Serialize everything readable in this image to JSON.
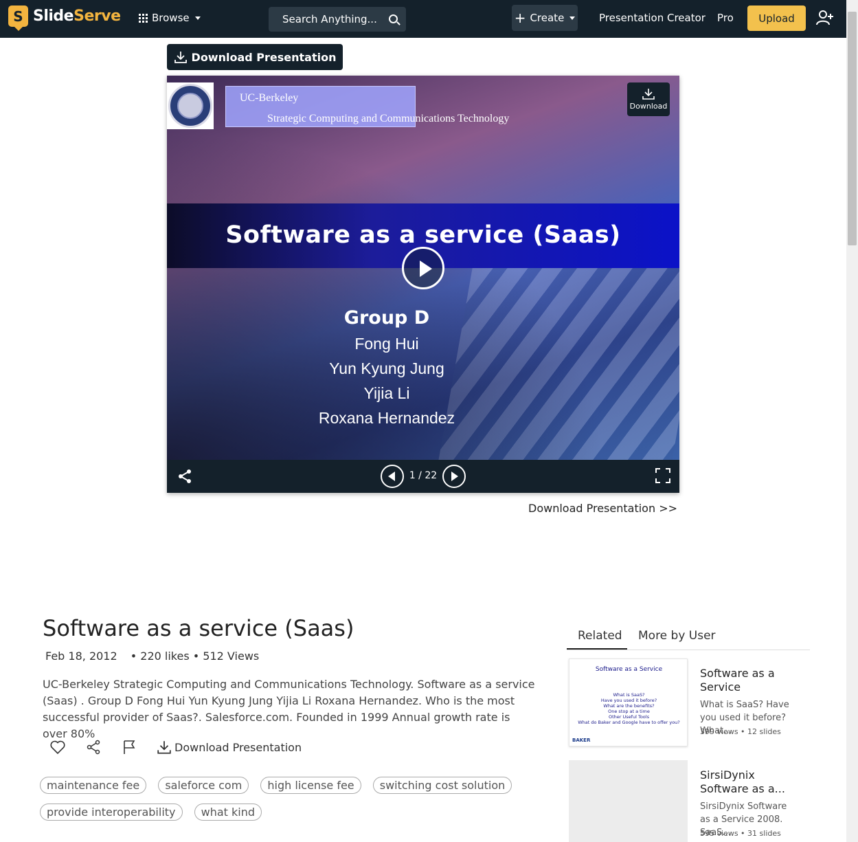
{
  "nav": {
    "logo_letter": "S",
    "logo_part1": "Slide",
    "logo_part2": "Serve",
    "browse_label": "Browse",
    "search_placeholder": "Search Anything...",
    "create_label": "Create",
    "presentation_creator_label": "Presentation Creator",
    "pro_label": "Pro",
    "upload_label": "Upload"
  },
  "download_top_label": "Download Presentation",
  "player": {
    "slide": {
      "uc_line1": "UC-Berkeley",
      "uc_line2": "Strategic Computing and Communications Technology",
      "title": "Software as a service (Saas)",
      "group_heading": "Group D",
      "members": [
        "Fong Hui",
        "Yun Kyung Jung",
        "Yijia Li",
        "Roxana Hernandez"
      ]
    },
    "download_mini_label": "Download",
    "current_page": "1",
    "total_pages": "22",
    "page_indicator": "1 / 22"
  },
  "download_link_label": "Download Presentation >>",
  "details": {
    "title": "Software as a service (Saas)",
    "date": "Feb 18, 2012",
    "likes": "• 220 likes",
    "views": "• 512 Views",
    "description": "UC-Berkeley Strategic Computing and Communications Technology. Software as a service (Saas) . Group D Fong Hui Yun Kyung Jung Yijia Li Roxana Hernandez. Who is the most successful provider of Saas?. Salesforce.com. Founded in 1999 Annual growth rate is over 80%",
    "download_label": "Download Presentation",
    "tags": [
      "maintenance fee",
      "saleforce com",
      "high license fee",
      "switching cost solution",
      "provide interoperability",
      "what kind"
    ]
  },
  "related": {
    "tab_related": "Related",
    "tab_more_by_user": "More by User",
    "items": [
      {
        "title": "Software as a Service",
        "description": "What is SaaS? Have you used it before? What...",
        "stats": "399 views • 12 slides",
        "thumb_title": "Software as a Service",
        "thumb_lines": [
          "What is SaaS?",
          "Have you used it before?",
          "What are the benefits?",
          "One stop at a time",
          "Other Useful Tools",
          "What do Baker and Google have to offer you?"
        ],
        "thumb_logo": "BAKER"
      },
      {
        "title": "SirsiDynix Software as a...",
        "description": "SirsiDynix Software as a Service 2008. SaaS...",
        "stats": "595 views • 31 slides"
      }
    ]
  }
}
